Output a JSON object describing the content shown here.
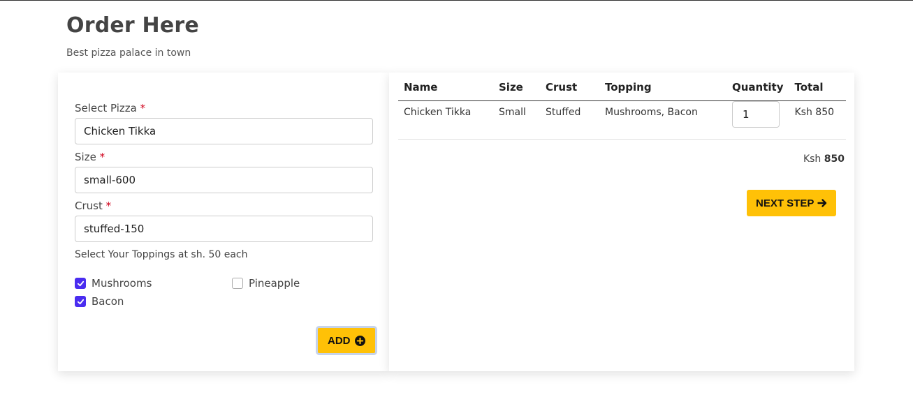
{
  "header": {
    "title": "Order Here",
    "subtitle": "Best pizza palace in town"
  },
  "form": {
    "pizza_label": "Select Pizza",
    "pizza_value": "Chicken Tikka",
    "size_label": "Size",
    "size_value": "small-600",
    "crust_label": "Crust",
    "crust_value": "stuffed-150",
    "required_mark": "*",
    "toppings_hint": "Select Your Toppings at sh. 50 each",
    "toppings": [
      {
        "label": "Mushrooms",
        "checked": true
      },
      {
        "label": "Pineapple",
        "checked": false
      },
      {
        "label": "Bacon",
        "checked": true
      }
    ],
    "add_label": "ADD"
  },
  "cart": {
    "columns": [
      "Name",
      "Size",
      "Crust",
      "Topping",
      "Quantity",
      "Total"
    ],
    "rows": [
      {
        "name": "Chicken Tikka",
        "size": "Small",
        "crust": "Stuffed",
        "topping": "Mushrooms, Bacon",
        "quantity": "1",
        "total": "Ksh 850"
      }
    ],
    "grand_prefix": "Ksh",
    "grand_total": "850",
    "next_label": "NEXT STEP"
  },
  "colors": {
    "accent": "#ffc107",
    "checkbox": "#4a2df0",
    "required": "#d0021b"
  }
}
